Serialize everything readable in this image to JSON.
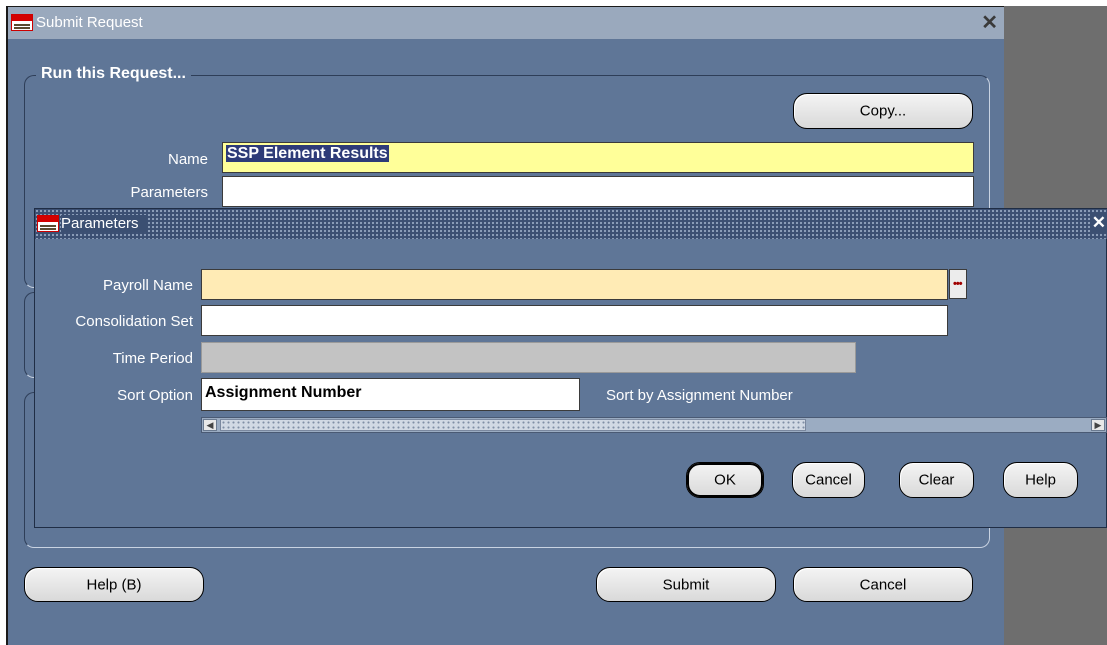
{
  "window": {
    "title": "Submit Request",
    "close_symbol": "✕"
  },
  "run_group": {
    "legend": "Run this Request..."
  },
  "copy_button": "Copy...",
  "name_field": {
    "label": "Name",
    "value": "SSP Element Results"
  },
  "parameters_field": {
    "label": "Parameters",
    "value": ""
  },
  "footer": {
    "help": "Help (B)",
    "submit": "Submit",
    "cancel": "Cancel"
  },
  "params_dialog": {
    "title": "Parameters",
    "close_symbol": "✕",
    "fields": {
      "payroll_name": {
        "label": "Payroll Name",
        "value": ""
      },
      "consolidation_set": {
        "label": "Consolidation Set",
        "value": ""
      },
      "time_period": {
        "label": "Time Period",
        "value": ""
      },
      "sort_option": {
        "label": "Sort Option",
        "value": "Assignment Number",
        "description": "Sort by Assignment Number"
      }
    },
    "buttons": {
      "ok": "OK",
      "cancel": "Cancel",
      "clear": "Clear",
      "help": "Help"
    },
    "lov_icon": "ellipsis-icon"
  },
  "colors": {
    "window_bg": "#5f7697",
    "title_bar": "#9aa9bd",
    "required_field": "#ffebb5",
    "current_field": "#ffff99"
  }
}
